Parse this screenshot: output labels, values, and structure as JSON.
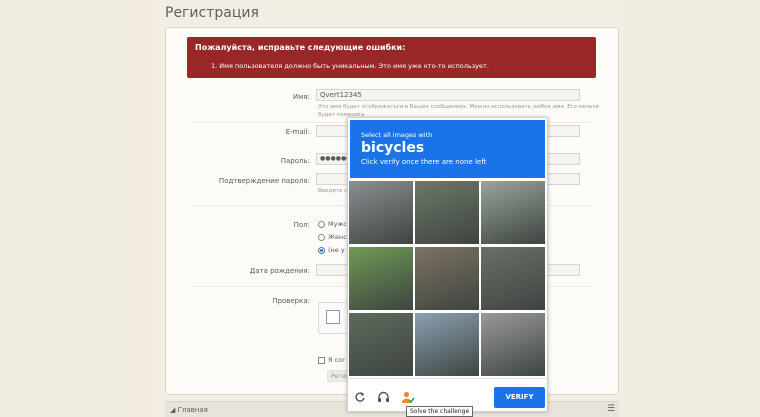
{
  "page": {
    "title": "Регистрация"
  },
  "error": {
    "title": "Пожалуйста, исправьте следующие ошибки:",
    "item": "1. Имя пользователя должно быть уникальным. Это имя уже кто-то использует."
  },
  "form": {
    "name_label": "Имя:",
    "name_value": "Qvert12345",
    "name_hint": "Это имя будет отображаться в Ваших сообщениях. Можно использовать любое имя. Его нельзя",
    "name_hint2": "будет поменять",
    "email_label": "E-mail:",
    "password_label": "Пароль:",
    "password_value": "●●●●●●",
    "confirm_label": "Подтверждение пароля:",
    "confirm_hint": "Введите с",
    "gender_label": "Пол:",
    "gender_options": [
      "Мужс",
      "Женс",
      "(не у"
    ],
    "gender_selected": 2,
    "birthday_label": "Дата рождения:",
    "check_label": "Проверка:",
    "agree_label": "Я сог",
    "register_label": "Регис"
  },
  "footer": {
    "home": "Главная",
    "menu_icon": "menu-icon"
  },
  "captcha": {
    "prompt_small": "Select all images with",
    "prompt_big": "bicycles",
    "prompt_sub": "Click verify once there are none left",
    "verify_label": "VERIFY",
    "tooltip": "Solve the challenge",
    "icons": [
      "refresh-icon",
      "audio-icon",
      "info-icon"
    ],
    "tiles": [
      "#8a8f92",
      "#6d7868",
      "#9aa39c",
      "#6f9a56",
      "#7d7262",
      "#6c6f6a",
      "#5e6a5c",
      "#8aa0b3",
      "#9a9a98"
    ]
  }
}
